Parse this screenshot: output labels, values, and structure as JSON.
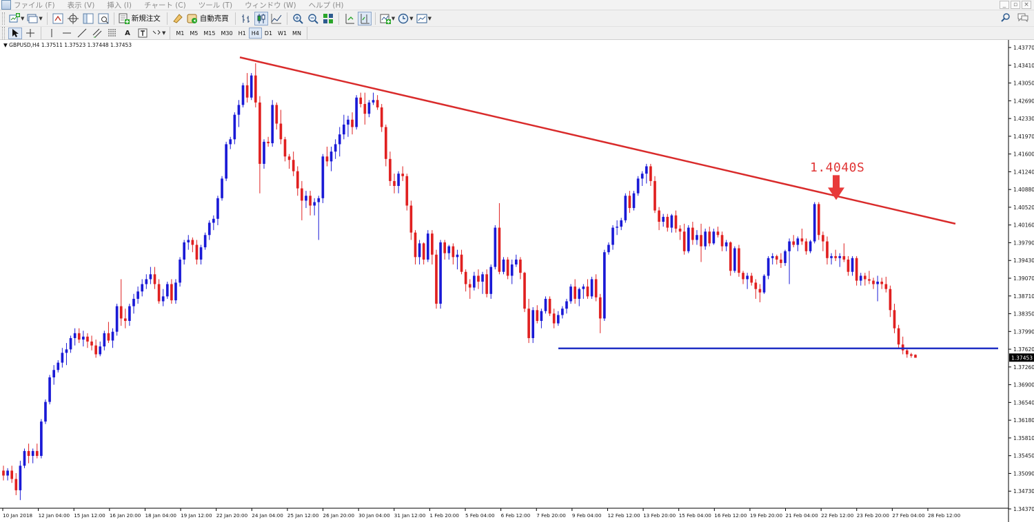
{
  "menu": {
    "items": [
      "ファイル (F)",
      "表示 (V)",
      "挿入 (I)",
      "チャート (C)",
      "ツール (T)",
      "ウィンドウ (W)",
      "ヘルプ (H)"
    ]
  },
  "toolbar": {
    "new_order_label": "新規注文",
    "auto_trade_label": "自動売買",
    "timeframes": [
      "M1",
      "M5",
      "M15",
      "M30",
      "H1",
      "H4",
      "D1",
      "W1",
      "MN"
    ],
    "active_timeframe": "H4"
  },
  "chart": {
    "symbol_info": "▼ GBPUSD,H4  1.37511 1.37523 1.37448 1.37453",
    "annotation_text": "1.4040S",
    "current_price_label": "1.37453",
    "colors": {
      "bull": "#1a1ad6",
      "bear": "#e02020",
      "trendline": "#d92b2b",
      "support_line": "#1f2fc4",
      "arrow": "#e83a3a"
    }
  },
  "chart_data": {
    "type": "candlestick",
    "symbol": "GBPUSD",
    "timeframe": "H4",
    "ylim": [
      1.3437,
      1.4377
    ],
    "y_ticks": [
      "1.43770",
      "1.43410",
      "1.43050",
      "1.42690",
      "1.42330",
      "1.41970",
      "1.41600",
      "1.41240",
      "1.40880",
      "1.40520",
      "1.40160",
      "1.39790",
      "1.39430",
      "1.39070",
      "1.38710",
      "1.38350",
      "1.37990",
      "1.37620",
      "1.37260",
      "1.36900",
      "1.36540",
      "1.36180",
      "1.35810",
      "1.35450",
      "1.35090",
      "1.34730",
      "1.34370"
    ],
    "x_ticks": [
      "10 Jan 2018",
      "12 Jan 04:00",
      "15 Jan 12:00",
      "16 Jan 20:00",
      "18 Jan 04:00",
      "19 Jan 12:00",
      "22 Jan 20:00",
      "24 Jan 04:00",
      "25 Jan 12:00",
      "26 Jan 20:00",
      "30 Jan 04:00",
      "31 Jan 12:00",
      "1 Feb 20:00",
      "5 Feb 04:00",
      "6 Feb 12:00",
      "7 Feb 20:00",
      "9 Feb 04:00",
      "12 Feb 12:00",
      "13 Feb 20:00",
      "15 Feb 04:00",
      "16 Feb 12:00",
      "19 Feb 20:00",
      "21 Feb 04:00",
      "22 Feb 12:00",
      "23 Feb 20:00",
      "27 Feb 04:00",
      "28 Feb 12:00"
    ],
    "candles": [
      [
        1.3515,
        1.3525,
        1.3495,
        1.3505
      ],
      [
        1.3505,
        1.352,
        1.3495,
        1.3515
      ],
      [
        1.3515,
        1.3525,
        1.349,
        1.3498
      ],
      [
        1.3498,
        1.351,
        1.3465,
        1.3475
      ],
      [
        1.3475,
        1.3535,
        1.3455,
        1.3525
      ],
      [
        1.3525,
        1.356,
        1.352,
        1.3555
      ],
      [
        1.3555,
        1.357,
        1.353,
        1.3545
      ],
      [
        1.3545,
        1.356,
        1.353,
        1.3555
      ],
      [
        1.3555,
        1.357,
        1.354,
        1.3545
      ],
      [
        1.3545,
        1.362,
        1.354,
        1.3615
      ],
      [
        1.3615,
        1.366,
        1.361,
        1.3655
      ],
      [
        1.3655,
        1.371,
        1.365,
        1.3705
      ],
      [
        1.3705,
        1.373,
        1.369,
        1.372
      ],
      [
        1.372,
        1.374,
        1.3715,
        1.3735
      ],
      [
        1.3735,
        1.3765,
        1.3725,
        1.3755
      ],
      [
        1.3755,
        1.3775,
        1.373,
        1.3762
      ],
      [
        1.3762,
        1.379,
        1.3755,
        1.3785
      ],
      [
        1.3785,
        1.3805,
        1.377,
        1.3795
      ],
      [
        1.3795,
        1.3805,
        1.3775,
        1.3782
      ],
      [
        1.3782,
        1.38,
        1.3768,
        1.3788
      ],
      [
        1.3788,
        1.3795,
        1.3765,
        1.3778
      ],
      [
        1.3778,
        1.379,
        1.376,
        1.377
      ],
      [
        1.377,
        1.3782,
        1.3745,
        1.3752
      ],
      [
        1.3752,
        1.3778,
        1.3748,
        1.3768
      ],
      [
        1.3768,
        1.38,
        1.376,
        1.3795
      ],
      [
        1.3795,
        1.3818,
        1.3775,
        1.378
      ],
      [
        1.378,
        1.3805,
        1.3765,
        1.3798
      ],
      [
        1.3798,
        1.3855,
        1.379,
        1.385
      ],
      [
        1.385,
        1.3905,
        1.381,
        1.3825
      ],
      [
        1.3825,
        1.3845,
        1.3805,
        1.382
      ],
      [
        1.382,
        1.3855,
        1.381,
        1.385
      ],
      [
        1.385,
        1.3875,
        1.3835,
        1.3865
      ],
      [
        1.3865,
        1.389,
        1.3855,
        1.388
      ],
      [
        1.388,
        1.3905,
        1.387,
        1.3895
      ],
      [
        1.3895,
        1.3915,
        1.3885,
        1.3905
      ],
      [
        1.3905,
        1.393,
        1.3895,
        1.3915
      ],
      [
        1.3915,
        1.393,
        1.3885,
        1.3895
      ],
      [
        1.3895,
        1.3905,
        1.3855,
        1.386
      ],
      [
        1.386,
        1.3885,
        1.385,
        1.387
      ],
      [
        1.387,
        1.39,
        1.3865,
        1.3895
      ],
      [
        1.3895,
        1.3905,
        1.3855,
        1.3862
      ],
      [
        1.3862,
        1.3905,
        1.3855,
        1.3898
      ],
      [
        1.3898,
        1.395,
        1.389,
        1.3945
      ],
      [
        1.3945,
        1.3985,
        1.3935,
        1.398
      ],
      [
        1.398,
        1.3995,
        1.3965,
        1.3985
      ],
      [
        1.3985,
        1.399,
        1.396,
        1.3975
      ],
      [
        1.3975,
        1.3985,
        1.3935,
        1.3945
      ],
      [
        1.3945,
        1.3975,
        1.3935,
        1.397
      ],
      [
        1.397,
        1.4,
        1.3965,
        1.3995
      ],
      [
        1.3995,
        1.4025,
        1.3985,
        1.402
      ],
      [
        1.402,
        1.4035,
        1.4005,
        1.4028
      ],
      [
        1.4028,
        1.4075,
        1.4015,
        1.407
      ],
      [
        1.407,
        1.4115,
        1.4065,
        1.411
      ],
      [
        1.411,
        1.4185,
        1.4105,
        1.418
      ],
      [
        1.418,
        1.4195,
        1.417,
        1.419
      ],
      [
        1.419,
        1.4245,
        1.418,
        1.424
      ],
      [
        1.424,
        1.427,
        1.4215,
        1.426
      ],
      [
        1.426,
        1.4305,
        1.4255,
        1.43
      ],
      [
        1.43,
        1.4325,
        1.4265,
        1.4275
      ],
      [
        1.4275,
        1.4325,
        1.427,
        1.432
      ],
      [
        1.432,
        1.4345,
        1.4255,
        1.4265
      ],
      [
        1.4265,
        1.4278,
        1.408,
        1.414
      ],
      [
        1.414,
        1.419,
        1.413,
        1.4185
      ],
      [
        1.4185,
        1.4195,
        1.4175,
        1.4182
      ],
      [
        1.4182,
        1.427,
        1.4175,
        1.426
      ],
      [
        1.426,
        1.4265,
        1.421,
        1.4222
      ],
      [
        1.4222,
        1.425,
        1.418,
        1.419
      ],
      [
        1.419,
        1.4195,
        1.4145,
        1.4155
      ],
      [
        1.4155,
        1.416,
        1.413,
        1.4148
      ],
      [
        1.4148,
        1.4165,
        1.4115,
        1.4125
      ],
      [
        1.4125,
        1.4135,
        1.4075,
        1.409
      ],
      [
        1.409,
        1.4105,
        1.4025,
        1.4065
      ],
      [
        1.4065,
        1.4085,
        1.405,
        1.4075
      ],
      [
        1.4075,
        1.4085,
        1.4035,
        1.4055
      ],
      [
        1.4055,
        1.407,
        1.4035,
        1.4062
      ],
      [
        1.4062,
        1.4075,
        1.3985,
        1.407
      ],
      [
        1.407,
        1.416,
        1.406,
        1.4155
      ],
      [
        1.4155,
        1.4175,
        1.4135,
        1.4145
      ],
      [
        1.4145,
        1.4175,
        1.4125,
        1.4165
      ],
      [
        1.4165,
        1.419,
        1.415,
        1.418
      ],
      [
        1.418,
        1.4215,
        1.4155,
        1.42
      ],
      [
        1.42,
        1.424,
        1.419,
        1.422
      ],
      [
        1.422,
        1.4238,
        1.4195,
        1.423
      ],
      [
        1.423,
        1.4245,
        1.42,
        1.4215
      ],
      [
        1.4215,
        1.428,
        1.421,
        1.4275
      ],
      [
        1.4275,
        1.4285,
        1.4255,
        1.4262
      ],
      [
        1.4262,
        1.4285,
        1.422,
        1.4242
      ],
      [
        1.4242,
        1.427,
        1.4235,
        1.4265
      ],
      [
        1.4265,
        1.4285,
        1.426,
        1.427
      ],
      [
        1.427,
        1.428,
        1.425,
        1.4255
      ],
      [
        1.4255,
        1.4262,
        1.4205,
        1.4215
      ],
      [
        1.4215,
        1.422,
        1.4135,
        1.415
      ],
      [
        1.415,
        1.4165,
        1.4095,
        1.4105
      ],
      [
        1.4105,
        1.412,
        1.408,
        1.4095
      ],
      [
        1.4095,
        1.4125,
        1.408,
        1.412
      ],
      [
        1.412,
        1.4135,
        1.4105,
        1.4115
      ],
      [
        1.4115,
        1.412,
        1.4045,
        1.4055
      ],
      [
        1.4055,
        1.4065,
        1.3985,
        1.4
      ],
      [
        1.4,
        1.4005,
        1.3935,
        1.395
      ],
      [
        1.395,
        1.3985,
        1.3935,
        1.3978
      ],
      [
        1.3978,
        1.398,
        1.3935,
        1.3945
      ],
      [
        1.3945,
        1.4005,
        1.394,
        1.3998
      ],
      [
        1.3998,
        1.4005,
        1.3935,
        1.3955
      ],
      [
        1.3955,
        1.3965,
        1.3845,
        1.3855
      ],
      [
        1.3855,
        1.3985,
        1.3845,
        1.398
      ],
      [
        1.398,
        1.3985,
        1.3945,
        1.3958
      ],
      [
        1.3958,
        1.3975,
        1.3945,
        1.3972
      ],
      [
        1.3972,
        1.3978,
        1.3935,
        1.395
      ],
      [
        1.395,
        1.3965,
        1.3925,
        1.3955
      ],
      [
        1.3955,
        1.3965,
        1.3915,
        1.392
      ],
      [
        1.392,
        1.3925,
        1.388,
        1.3895
      ],
      [
        1.3895,
        1.3905,
        1.3865,
        1.3888
      ],
      [
        1.3888,
        1.392,
        1.3882,
        1.3912
      ],
      [
        1.3912,
        1.3925,
        1.3885,
        1.39
      ],
      [
        1.39,
        1.392,
        1.3875,
        1.3915
      ],
      [
        1.3915,
        1.3925,
        1.3868,
        1.3875
      ],
      [
        1.3875,
        1.3935,
        1.3865,
        1.393
      ],
      [
        1.393,
        1.4015,
        1.3925,
        1.401
      ],
      [
        1.401,
        1.406,
        1.3915,
        1.392
      ],
      [
        1.392,
        1.395,
        1.3915,
        1.3945
      ],
      [
        1.3945,
        1.395,
        1.3905,
        1.3912
      ],
      [
        1.3912,
        1.3945,
        1.3895,
        1.3935
      ],
      [
        1.3935,
        1.3955,
        1.393,
        1.3945
      ],
      [
        1.3945,
        1.395,
        1.3905,
        1.3918
      ],
      [
        1.3918,
        1.392,
        1.3838,
        1.3845
      ],
      [
        1.3845,
        1.3865,
        1.3775,
        1.3785
      ],
      [
        1.3785,
        1.3848,
        1.3775,
        1.3842
      ],
      [
        1.3842,
        1.3852,
        1.3815,
        1.382
      ],
      [
        1.382,
        1.3845,
        1.3805,
        1.384
      ],
      [
        1.384,
        1.387,
        1.3835,
        1.3865
      ],
      [
        1.3865,
        1.387,
        1.383,
        1.3835
      ],
      [
        1.3835,
        1.3845,
        1.3805,
        1.3815
      ],
      [
        1.3815,
        1.384,
        1.381,
        1.3832
      ],
      [
        1.3832,
        1.385,
        1.3825,
        1.3845
      ],
      [
        1.3845,
        1.3865,
        1.3835,
        1.386
      ],
      [
        1.386,
        1.3895,
        1.3855,
        1.389
      ],
      [
        1.389,
        1.3905,
        1.3855,
        1.3865
      ],
      [
        1.3865,
        1.3888,
        1.385,
        1.3885
      ],
      [
        1.3885,
        1.3895,
        1.3865,
        1.389
      ],
      [
        1.389,
        1.3905,
        1.3865,
        1.387
      ],
      [
        1.387,
        1.391,
        1.3865,
        1.3905
      ],
      [
        1.3905,
        1.3915,
        1.386,
        1.3868
      ],
      [
        1.3868,
        1.3875,
        1.3795,
        1.3825
      ],
      [
        1.3825,
        1.3965,
        1.382,
        1.396
      ],
      [
        1.396,
        1.398,
        1.3955,
        1.3975
      ],
      [
        1.3975,
        1.4015,
        1.3965,
        1.401
      ],
      [
        1.401,
        1.4025,
        1.3995,
        1.4012
      ],
      [
        1.4012,
        1.403,
        1.4005,
        1.4025
      ],
      [
        1.4025,
        1.408,
        1.402,
        1.4075
      ],
      [
        1.4075,
        1.4085,
        1.404,
        1.405
      ],
      [
        1.405,
        1.4085,
        1.4045,
        1.408
      ],
      [
        1.408,
        1.4115,
        1.4075,
        1.411
      ],
      [
        1.411,
        1.4125,
        1.4095,
        1.412
      ],
      [
        1.412,
        1.414,
        1.41,
        1.4135
      ],
      [
        1.4135,
        1.414,
        1.4095,
        1.4105
      ],
      [
        1.4105,
        1.4115,
        1.404,
        1.4045
      ],
      [
        1.4045,
        1.4052,
        1.4005,
        1.4022
      ],
      [
        1.4022,
        1.4038,
        1.4012,
        1.4032
      ],
      [
        1.4032,
        1.4038,
        1.4002,
        1.401
      ],
      [
        1.401,
        1.4038,
        1.4,
        1.4035
      ],
      [
        1.4035,
        1.4045,
        1.4,
        1.4008
      ],
      [
        1.4008,
        1.4015,
        1.3985,
        1.4002
      ],
      [
        1.4002,
        1.4018,
        1.3955,
        1.3962
      ],
      [
        1.3962,
        1.4015,
        1.3958,
        1.401
      ],
      [
        1.401,
        1.4022,
        1.3975,
        1.3985
      ],
      [
        1.3985,
        1.4005,
        1.3975,
        1.3995
      ],
      [
        1.3995,
        1.4018,
        1.394,
        1.3972
      ],
      [
        1.3972,
        1.4008,
        1.3965,
        1.4002
      ],
      [
        1.4002,
        1.4012,
        1.3972,
        1.3978
      ],
      [
        1.3978,
        1.4008,
        1.3975,
        1.4002
      ],
      [
        1.4002,
        1.4012,
        1.399,
        1.3995
      ],
      [
        1.3995,
        1.4002,
        1.3962,
        1.3972
      ],
      [
        1.3972,
        1.3985,
        1.3962,
        1.398
      ],
      [
        1.398,
        1.3982,
        1.3912,
        1.3922
      ],
      [
        1.3922,
        1.3972,
        1.3918,
        1.3968
      ],
      [
        1.3968,
        1.3975,
        1.391,
        1.3918
      ],
      [
        1.3918,
        1.3922,
        1.3895,
        1.3905
      ],
      [
        1.3905,
        1.3918,
        1.3885,
        1.3912
      ],
      [
        1.3912,
        1.3918,
        1.3892,
        1.3898
      ],
      [
        1.3898,
        1.3905,
        1.3865,
        1.3885
      ],
      [
        1.3885,
        1.3895,
        1.3858,
        1.3878
      ],
      [
        1.3878,
        1.3915,
        1.3875,
        1.3912
      ],
      [
        1.3912,
        1.3952,
        1.3905,
        1.3948
      ],
      [
        1.3948,
        1.3958,
        1.3935,
        1.3952
      ],
      [
        1.3952,
        1.3955,
        1.3935,
        1.3945
      ],
      [
        1.3945,
        1.3958,
        1.3928,
        1.3938
      ],
      [
        1.3938,
        1.3965,
        1.3932,
        1.3962
      ],
      [
        1.3962,
        1.3988,
        1.3895,
        1.3982
      ],
      [
        1.3982,
        1.3995,
        1.397,
        1.3975
      ],
      [
        1.3975,
        1.3992,
        1.3962,
        1.3988
      ],
      [
        1.3988,
        1.4008,
        1.3975,
        1.3982
      ],
      [
        1.3982,
        1.3988,
        1.3955,
        1.3962
      ],
      [
        1.3962,
        1.3985,
        1.3958,
        1.3982
      ],
      [
        1.3982,
        1.4062,
        1.3978,
        1.4058
      ],
      [
        1.4058,
        1.4062,
        1.3985,
        1.3995
      ],
      [
        1.3995,
        1.4002,
        1.3962,
        1.3982
      ],
      [
        1.3982,
        1.3992,
        1.3935,
        1.3948
      ],
      [
        1.3948,
        1.3958,
        1.3935,
        1.3952
      ],
      [
        1.3952,
        1.3965,
        1.3942,
        1.3948
      ],
      [
        1.3948,
        1.3958,
        1.393,
        1.3952
      ],
      [
        1.3952,
        1.3978,
        1.394,
        1.3945
      ],
      [
        1.3945,
        1.3952,
        1.3912,
        1.392
      ],
      [
        1.392,
        1.3952,
        1.3912,
        1.3948
      ],
      [
        1.3948,
        1.3952,
        1.3892,
        1.3902
      ],
      [
        1.3902,
        1.3918,
        1.3892,
        1.3912
      ],
      [
        1.3912,
        1.3918,
        1.3892,
        1.3905
      ],
      [
        1.3905,
        1.3922,
        1.3895,
        1.3902
      ],
      [
        1.3902,
        1.3908,
        1.3885,
        1.3895
      ],
      [
        1.3895,
        1.3912,
        1.386,
        1.39
      ],
      [
        1.39,
        1.3908,
        1.3885,
        1.3895
      ],
      [
        1.3895,
        1.391,
        1.3878,
        1.3885
      ],
      [
        1.3885,
        1.3892,
        1.3828,
        1.3842
      ],
      [
        1.3842,
        1.3855,
        1.3795,
        1.3805
      ],
      [
        1.3805,
        1.3812,
        1.3765,
        1.3772
      ],
      [
        1.3772,
        1.3788,
        1.3752,
        1.376
      ],
      [
        1.376,
        1.3765,
        1.3745,
        1.3752
      ],
      [
        1.3752,
        1.3755,
        1.3745,
        1.3749
      ],
      [
        1.3751,
        1.3752,
        1.3745,
        1.3745
      ]
    ],
    "trendline": {
      "from": {
        "candle": 0,
        "price": 1.4357
      },
      "note": "descending resistance from ~1.4357 to ~1.4018"
    },
    "trendline_points": [
      [
        1.4357,
        0
      ],
      [
        1.4018,
        1
      ]
    ],
    "support_level": 1.3764,
    "annotations": [
      {
        "text": "1.4040S",
        "type": "arrow-down",
        "price": 1.4058
      }
    ],
    "current_price": 1.37453
  }
}
